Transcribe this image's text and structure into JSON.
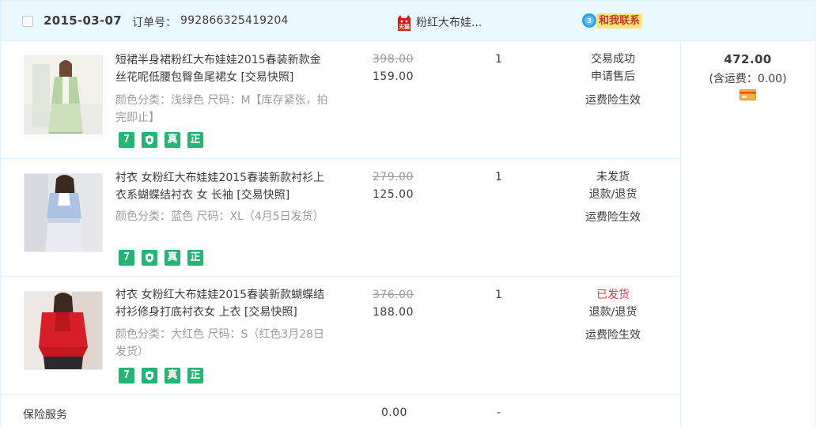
{
  "order": {
    "date": "2015-03-07",
    "order_no_label": "订单号：",
    "order_no": "992866325419204",
    "shop_name": "粉红大布娃...",
    "tmall_logo_text": "天猫",
    "ww_badge": "3",
    "contact_label": "和我联系",
    "total": "472.00",
    "shipping": "(含运费：0.00)",
    "icons": {
      "tmall": "tmall-icon",
      "wangwang": "wangwang-icon",
      "card": "card-icon"
    }
  },
  "items": [
    {
      "title": "短裙半身裙粉红大布娃娃2015春装新款金丝花呢低腰包臀鱼尾裙女 [交易快照]",
      "sku": "颜色分类：浅绿色 尺码：M【库存紧张，拍完即止】",
      "orig_price": "398.00",
      "price": "159.00",
      "qty": "1",
      "status": "交易成功",
      "status_color": "#3c3c3c",
      "action": "申请售后",
      "insurance": "运费险生效",
      "badges": [
        "7",
        "",
        "真",
        "正"
      ],
      "image": "green tweed jacket and lace skirt"
    },
    {
      "title": "衬衣 女粉红大布娃娃2015春装新款衬衫上衣系蝴蝶结衬衣 女 长袖 [交易快照]",
      "sku": "颜色分类：蓝色 尺码：XL（4月5日发货）",
      "orig_price": "279.00",
      "price": "125.00",
      "qty": "1",
      "status": "未发货",
      "status_color": "#3c3c3c",
      "action": "退款/退货",
      "insurance": "运费险生效",
      "badges": [
        "7",
        "",
        "真",
        "正"
      ],
      "image": "light blue bow blouse with lace skirt"
    },
    {
      "title": "衬衣 女粉红大布娃娃2015春装新款蝴蝶结衬衫修身打底衬衣女 上衣 [交易快照]",
      "sku": "颜色分类：大红色 尺码：S（红色3月28日发货）",
      "orig_price": "376.00",
      "price": "188.00",
      "qty": "1",
      "status": "已发货",
      "status_color": "#e4393c",
      "action": "退款/退货",
      "insurance": "运费险生效",
      "badges": [
        "7",
        "",
        "真",
        "正"
      ],
      "image": "red ruffle blouse"
    }
  ],
  "service": {
    "label": "保险服务",
    "price": "0.00",
    "qty": "-"
  }
}
